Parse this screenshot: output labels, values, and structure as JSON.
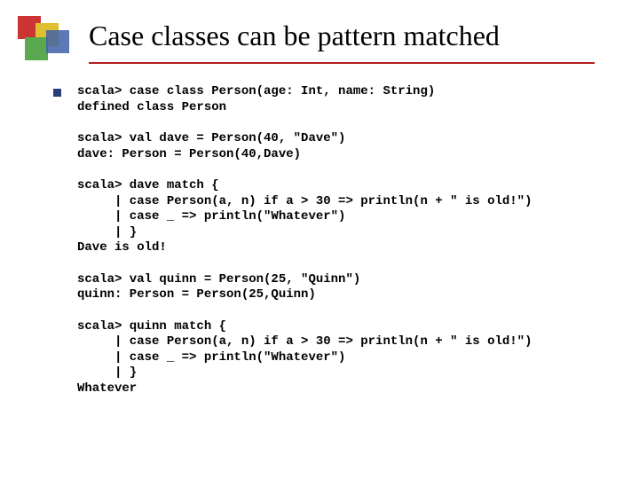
{
  "title": "Case classes can be pattern matched",
  "code": [
    "scala> case class Person(age: Int, name: String)\ndefined class Person",
    "scala> val dave = Person(40, \"Dave\")\ndave: Person = Person(40,Dave)",
    "scala> dave match {\n     | case Person(a, n) if a > 30 => println(n + \" is old!\")\n     | case _ => println(\"Whatever\")\n     | }\nDave is old!",
    "scala> val quinn = Person(25, \"Quinn\")\nquinn: Person = Person(25,Quinn)",
    "scala> quinn match {\n     | case Person(a, n) if a > 30 => println(n + \" is old!\")\n     | case _ => println(\"Whatever\")\n     | }\nWhatever"
  ]
}
